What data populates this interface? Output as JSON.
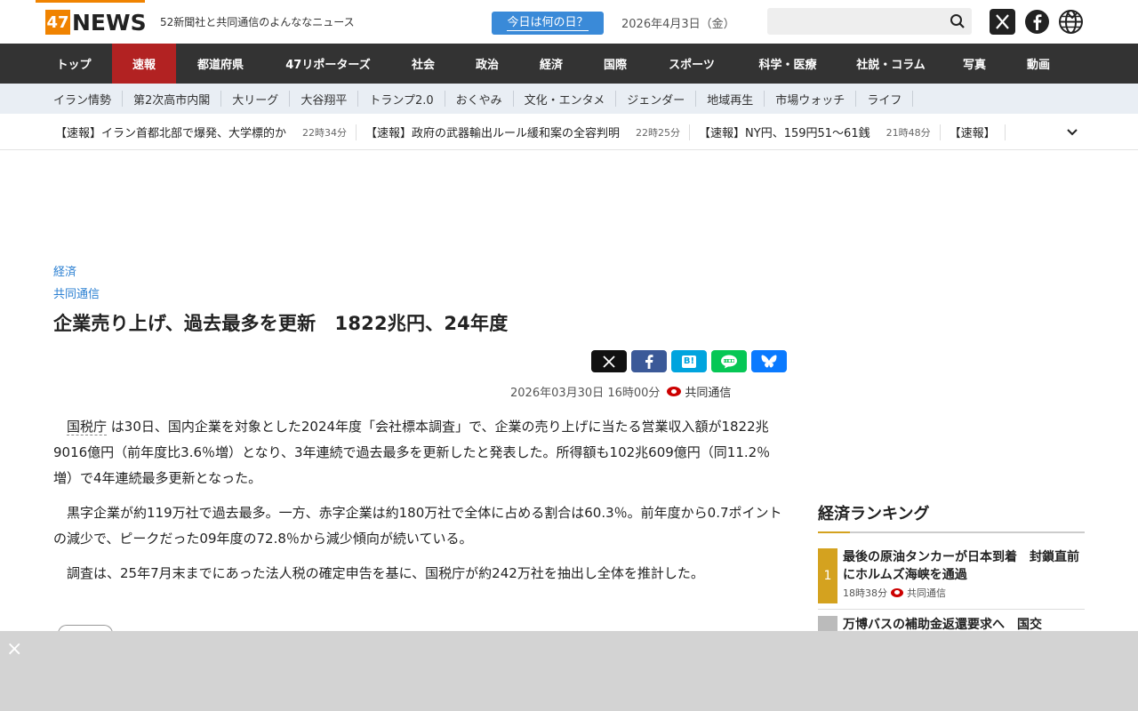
{
  "header": {
    "logo_num": "47",
    "logo_text": "NEWS",
    "tagline": "52新聞社と共同通信のよんななニュース",
    "today_btn": "今日は何の日？",
    "date": "2026年4月3日（金）",
    "search_placeholder": ""
  },
  "mainnav": [
    {
      "label": "トップ",
      "width": 86
    },
    {
      "label": "速報",
      "width": 72,
      "active": true
    },
    {
      "label": "都道府県",
      "width": 100
    },
    {
      "label": "47リポーターズ",
      "width": 142
    },
    {
      "label": "社会",
      "width": 72
    },
    {
      "label": "政治",
      "width": 72
    },
    {
      "label": "経済",
      "width": 72
    },
    {
      "label": "国際",
      "width": 72
    },
    {
      "label": "スポーツ",
      "width": 100
    },
    {
      "label": "科学・医療",
      "width": 116
    },
    {
      "label": "社説・コラム",
      "width": 116
    },
    {
      "label": "写真",
      "width": 72
    },
    {
      "label": "動画",
      "width": 72
    }
  ],
  "subnav": [
    "イラン情勢",
    "第2次高市内閣",
    "大リーグ",
    "大谷翔平",
    "トランプ2.0",
    "おくやみ",
    "文化・エンタメ",
    "ジェンダー",
    "地域再生",
    "市場ウォッチ",
    "ライフ"
  ],
  "ticker": [
    {
      "title": "【速報】イラン首都北部で爆発、大学標的か",
      "time": "22時34分"
    },
    {
      "title": "【速報】政府の武器輸出ルール緩和案の全容判明",
      "time": "22時25分"
    },
    {
      "title": "【速報】NY円、159円51～61銭",
      "time": "21時48分"
    },
    {
      "title": "【速報】",
      "time": ""
    }
  ],
  "article": {
    "category": "経済",
    "agency": "共同通信",
    "headline": "企業売り上げ、過去最多を更新　1822兆円、24年度",
    "date": "2026年03月30日",
    "time": "16時00分",
    "source": "共同通信",
    "term": "国税庁",
    "p1_rest": "は30日、国内企業を対象とした2024年度「会社標本調査」で、企業の売り上げに当たる営業収入額が1822兆9016億円（前年度比3.6％増）となり、3年連続で過去最多を更新したと発表した。所得額も102兆609億円（同11.2％増）で4年連続最多更新となった。",
    "p2": "黒字企業が約119万社で過去最多。一方、赤字企業は約180万社で全体に占める割合は60.3％。前年度から0.7ポイントの減少で、ピークだった09年度の72.8％から減少傾向が続いている。",
    "p3": "調査は、25年7月末までにあった法人税の確定申告を基に、国税庁が約242万社を抽出し全体を推計した。"
  },
  "share": {
    "hb": "B!"
  },
  "ranking": {
    "title": "経済ランキング",
    "items": [
      {
        "rank": "1",
        "headline": "最後の原油タンカーが日本到着　封鎖直前にホルムズ海峡を通過",
        "time": "18時38分",
        "source": "共同通信"
      },
      {
        "rank": "",
        "headline": "万博バスの補助金返還要求へ　国交",
        "time": "",
        "source": ""
      }
    ]
  },
  "ad": {
    "close": "×"
  }
}
